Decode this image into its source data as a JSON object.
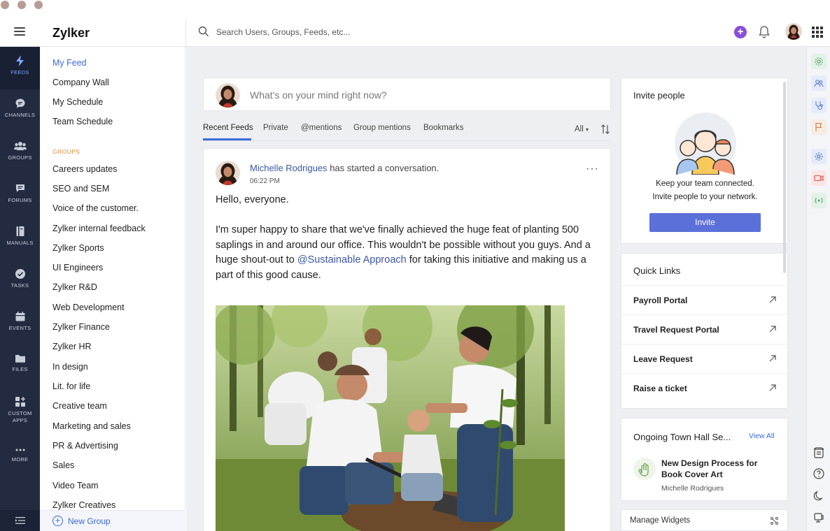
{
  "app": {
    "brand": "Zylker",
    "search_placeholder": "Search Users, Groups, Feeds, etc..."
  },
  "rail": [
    {
      "label": "FEEDS",
      "icon": "bolt-icon",
      "active": true
    },
    {
      "label": "CHANNELS",
      "icon": "chat-bubble-icon"
    },
    {
      "label": "GROUPS",
      "icon": "people-icon"
    },
    {
      "label": "FORUMS",
      "icon": "forum-icon"
    },
    {
      "label": "MANUALS",
      "icon": "book-icon"
    },
    {
      "label": "TASKS",
      "icon": "check-circle-icon"
    },
    {
      "label": "EVENTS",
      "icon": "calendar-icon"
    },
    {
      "label": "FILES",
      "icon": "folder-icon"
    },
    {
      "label": "CUSTOM APPS",
      "icon": "custom-apps-icon"
    },
    {
      "label": "MORE",
      "icon": "more-dots-icon"
    }
  ],
  "sidebar": {
    "top_links": [
      "My Feed",
      "Company Wall",
      "My Schedule",
      "Team Schedule"
    ],
    "groups_heading": "GROUPS",
    "groups": [
      "Careers updates",
      "SEO and SEM",
      "Voice of the customer.",
      "Zylker internal feedback",
      "Zylker Sports",
      "UI Engineers",
      "Zylker R&D",
      "Web Development",
      "Zylker Finance",
      "Zylker HR",
      "In design",
      "Lit. for life",
      "Creative team",
      "Marketing and sales",
      "PR & Advertising",
      "Sales",
      "Video Team",
      "Zylker Creatives"
    ],
    "new_group": "New Group"
  },
  "composer": {
    "placeholder": "What's on your mind right now?"
  },
  "tabs": [
    "Recent Feeds",
    "Private",
    "@mentions",
    "Group mentions",
    "Bookmarks"
  ],
  "filter": "All",
  "post": {
    "author": "Michelle Rodrigues",
    "action": "has started a conversation.",
    "time": "06:22 PM",
    "more": "···",
    "greeting": "Hello, everyone.",
    "body_before": "I'm super happy to share that we've finally achieved the huge feat of planting 500 saplings in and around our office. This wouldn't be possible without you guys. And a huge shout-out to ",
    "mention": "@Sustainable Approach",
    "body_after": " for taking this initiative and making us a part of this good cause."
  },
  "invite": {
    "title": "Invite people",
    "line1": "Keep your team connected.",
    "line2": "Invite people to your network.",
    "button": "Invite"
  },
  "quick_links": {
    "title": "Quick Links",
    "items": [
      "Payroll Portal",
      "Travel Request Portal",
      "Leave Request",
      "Raise a ticket"
    ]
  },
  "town_hall": {
    "title": "Ongoing Town Hall Se...",
    "view_all": "View All",
    "item_title": "New Design Process for Book Cover Art",
    "item_author": "Michelle Rodrigues"
  },
  "manage_widgets": "Manage Widgets",
  "colors": {
    "accent": "#3d6ad6",
    "rail_bg": "#232b41",
    "groups_heading": "#e38a37",
    "invite_button": "#5b70d9",
    "add_button": "#8a4ddb"
  }
}
